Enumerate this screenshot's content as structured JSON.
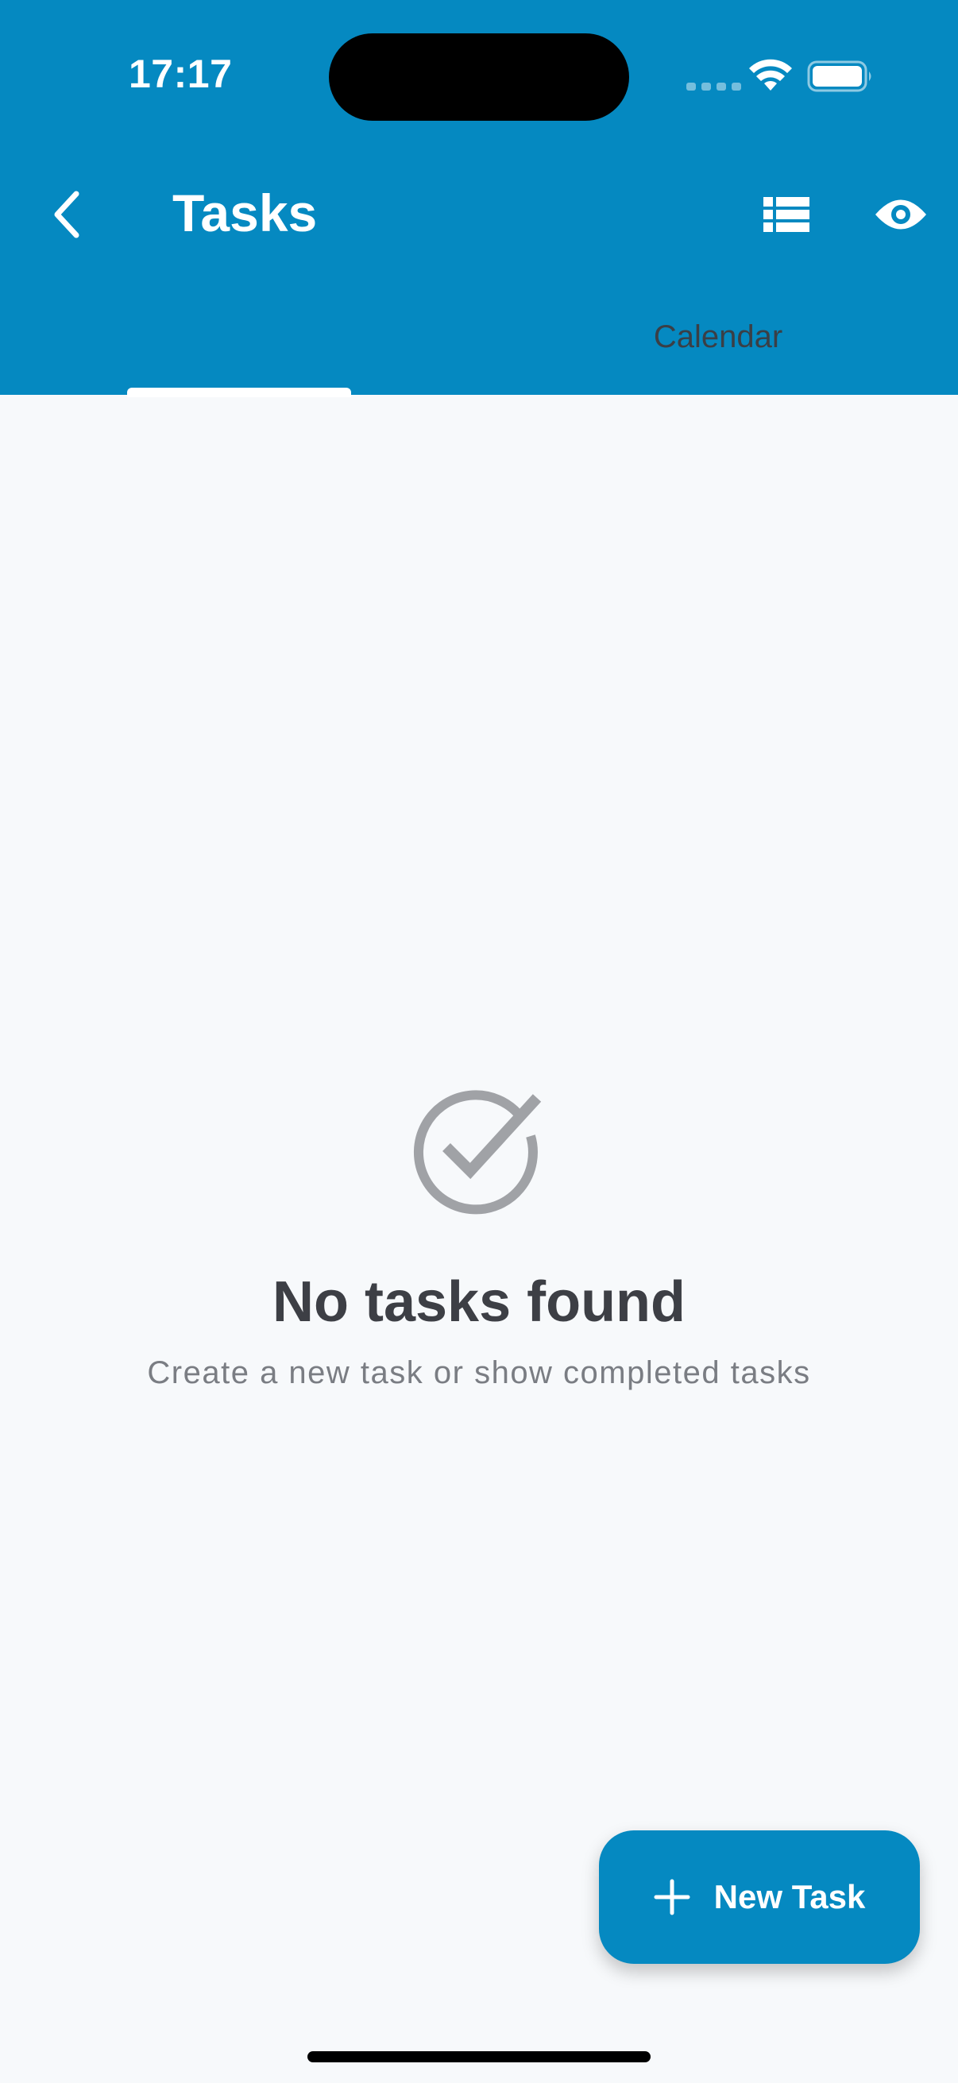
{
  "status_bar": {
    "time": "17:17"
  },
  "app_bar": {
    "title": "Tasks",
    "back_icon": "chevron-left-icon",
    "actions": [
      {
        "icon": "list-icon"
      },
      {
        "icon": "eye-icon"
      }
    ]
  },
  "tabs": {
    "items": [
      {
        "label": ""
      },
      {
        "label": "Calendar"
      }
    ],
    "selected_index": 0
  },
  "empty_state": {
    "icon": "check-circle-icon",
    "title": "No tasks found",
    "subtitle": "Create a new task or show completed tasks"
  },
  "fab": {
    "icon": "plus-icon",
    "label": "New Task"
  },
  "colors": {
    "primary": "#0589c1",
    "background": "#f7f9fb",
    "title_text": "#3d3f45",
    "subtitle_text": "#7a7d83",
    "icon_gray": "#a0a2a6",
    "inactive_tab_text": "#3a3f46"
  }
}
